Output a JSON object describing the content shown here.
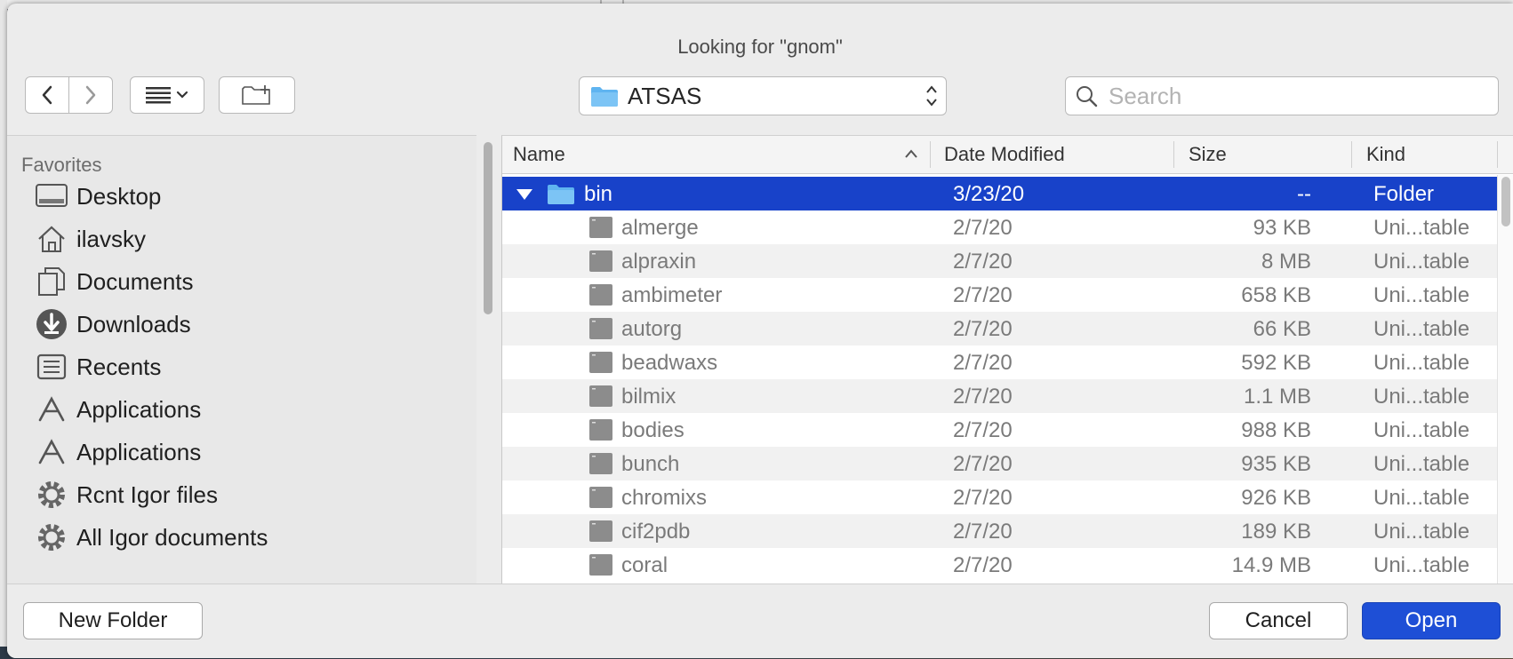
{
  "dialog": {
    "title": "Looking for \"gnom\""
  },
  "toolbar": {
    "back_icon": "chevron-left-icon",
    "forward_icon": "chevron-right-icon",
    "view_icon": "list-view-icon",
    "new_folder_icon": "new-folder-icon"
  },
  "location": {
    "folder": "ATSAS"
  },
  "search": {
    "placeholder": "Search",
    "value": ""
  },
  "sidebar": {
    "section": "Favorites",
    "items": [
      {
        "label": "Desktop",
        "icon": "desktop-icon"
      },
      {
        "label": "ilavsky",
        "icon": "home-icon"
      },
      {
        "label": "Documents",
        "icon": "documents-icon"
      },
      {
        "label": "Downloads",
        "icon": "downloads-icon"
      },
      {
        "label": "Recents",
        "icon": "recents-icon"
      },
      {
        "label": "Applications",
        "icon": "applications-icon"
      },
      {
        "label": "Applications",
        "icon": "applications-icon"
      },
      {
        "label": "Rcnt Igor files",
        "icon": "gear-icon"
      },
      {
        "label": "All Igor documents",
        "icon": "gear-icon"
      }
    ]
  },
  "columns": {
    "name": "Name",
    "date": "Date Modified",
    "size": "Size",
    "kind": "Kind"
  },
  "folder_row": {
    "name": "bin",
    "date": "3/23/20",
    "size": "--",
    "kind": "Folder"
  },
  "files": [
    {
      "name": "almerge",
      "date": "2/7/20",
      "size": "93 KB",
      "kind": "Uni...table"
    },
    {
      "name": "alpraxin",
      "date": "2/7/20",
      "size": "8 MB",
      "kind": "Uni...table"
    },
    {
      "name": "ambimeter",
      "date": "2/7/20",
      "size": "658 KB",
      "kind": "Uni...table"
    },
    {
      "name": "autorg",
      "date": "2/7/20",
      "size": "66 KB",
      "kind": "Uni...table"
    },
    {
      "name": "beadwaxs",
      "date": "2/7/20",
      "size": "592 KB",
      "kind": "Uni...table"
    },
    {
      "name": "bilmix",
      "date": "2/7/20",
      "size": "1.1 MB",
      "kind": "Uni...table"
    },
    {
      "name": "bodies",
      "date": "2/7/20",
      "size": "988 KB",
      "kind": "Uni...table"
    },
    {
      "name": "bunch",
      "date": "2/7/20",
      "size": "935 KB",
      "kind": "Uni...table"
    },
    {
      "name": "chromixs",
      "date": "2/7/20",
      "size": "926 KB",
      "kind": "Uni...table"
    },
    {
      "name": "cif2pdb",
      "date": "2/7/20",
      "size": "189 KB",
      "kind": "Uni...table"
    },
    {
      "name": "coral",
      "date": "2/7/20",
      "size": "14.9 MB",
      "kind": "Uni...table"
    }
  ],
  "buttons": {
    "new_folder": "New Folder",
    "cancel": "Cancel",
    "open": "Open"
  },
  "colors": {
    "selection": "#1842c9",
    "primary_button": "#1e4fd6",
    "folder_blue": "#5fb4f0"
  }
}
